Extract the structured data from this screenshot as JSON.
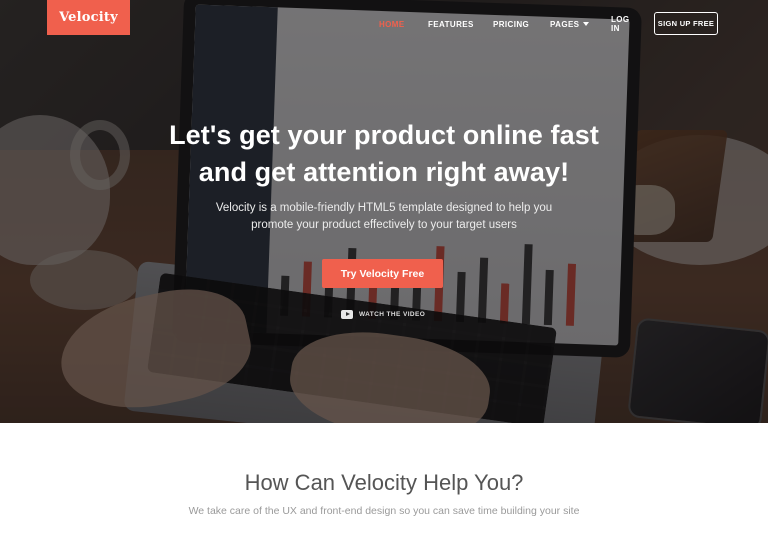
{
  "brand": {
    "name": "Velocity",
    "color": "#f0604d"
  },
  "nav": {
    "items": [
      {
        "label": "HOME",
        "active": true
      },
      {
        "label": "FEATURES",
        "active": false
      },
      {
        "label": "PRICING",
        "active": false
      },
      {
        "label": "PAGES",
        "active": false,
        "has_dropdown": true
      },
      {
        "label": "LOG IN",
        "active": false
      }
    ],
    "signup_label": "SIGN UP FREE"
  },
  "hero": {
    "headline_line1": "Let's get your product online fast",
    "headline_line2": "and get attention right away!",
    "subline_line1": "Velocity is a mobile-friendly HTML5 template designed to help you",
    "subline_line2": "promote your product effectively to your target users",
    "cta_label": "Try Velocity Free",
    "watch_label": "WATCH THE VIDEO",
    "watch_icon": "play-icon"
  },
  "section": {
    "title": "How Can Velocity Help You?",
    "subtitle": "We take care of the UX and front-end design so you can save time building your site"
  }
}
